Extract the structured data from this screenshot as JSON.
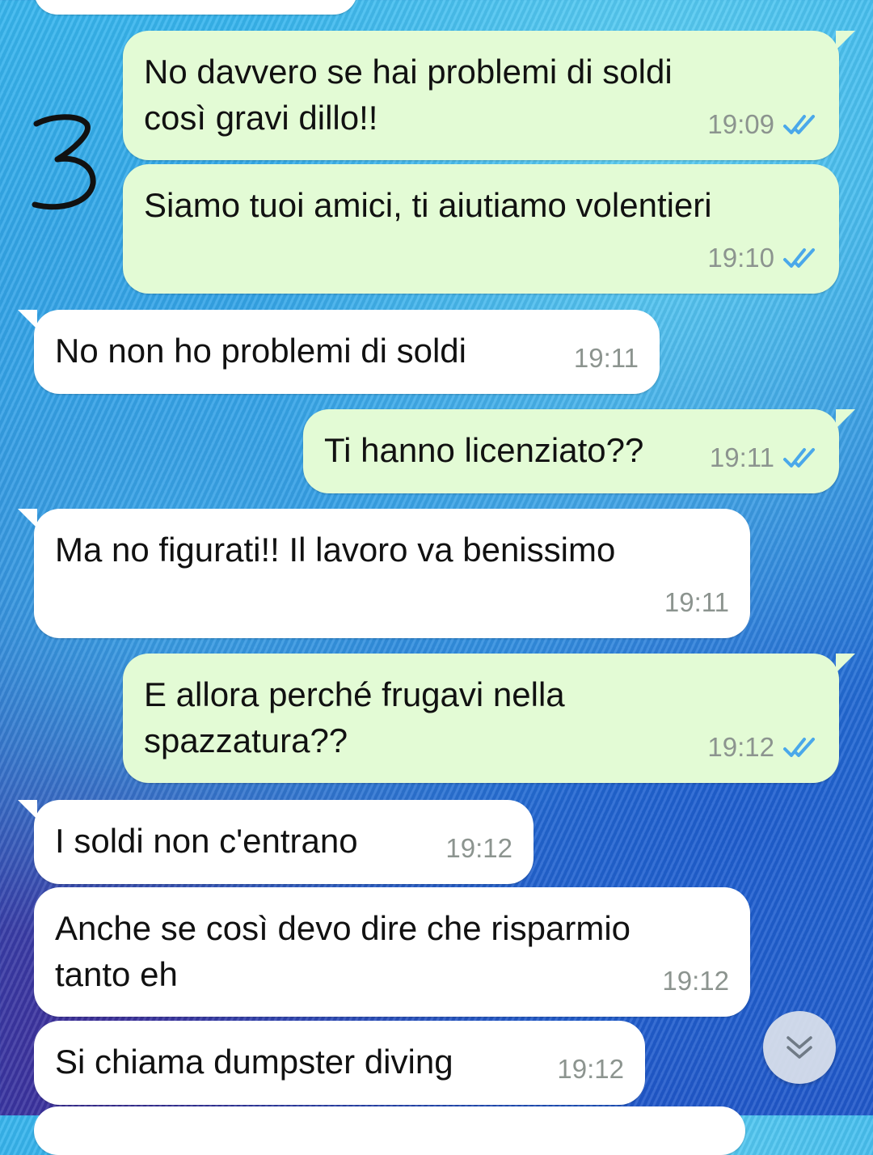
{
  "colors": {
    "outgoing_bubble": "#e3fbd5",
    "incoming_bubble": "#ffffff",
    "read_ticks": "#4aa8ea",
    "timestamp": "#8c948f"
  },
  "annotation": {
    "number": "3"
  },
  "messages": [
    {
      "direction": "outgoing",
      "lines": [
        "No davvero se hai problemi di soldi",
        "così gravi dillo!!"
      ],
      "time": "19:09",
      "status": "read",
      "status_icon": "double-check-icon"
    },
    {
      "direction": "outgoing",
      "lines": [
        "Siamo tuoi amici, ti aiutiamo volentieri"
      ],
      "time": "19:10",
      "status": "read",
      "status_icon": "double-check-icon"
    },
    {
      "direction": "incoming",
      "lines": [
        "No non ho problemi di soldi"
      ],
      "time": "19:11"
    },
    {
      "direction": "outgoing",
      "lines": [
        "Ti hanno licenziato??"
      ],
      "time": "19:11",
      "status": "read",
      "status_icon": "double-check-icon"
    },
    {
      "direction": "incoming",
      "lines": [
        "Ma no figurati!! Il lavoro va benissimo"
      ],
      "time": "19:11"
    },
    {
      "direction": "outgoing",
      "lines": [
        "E allora perché frugavi nella",
        "spazzatura??"
      ],
      "time": "19:12",
      "status": "read",
      "status_icon": "double-check-icon"
    },
    {
      "direction": "incoming",
      "lines": [
        "I soldi non c'entrano"
      ],
      "time": "19:12"
    },
    {
      "direction": "incoming",
      "lines": [
        "Anche se così devo dire che risparmio",
        "tanto eh"
      ],
      "time": "19:12"
    },
    {
      "direction": "incoming",
      "lines": [
        "Si chiama dumpster diving"
      ],
      "time": "19:12"
    }
  ],
  "scroll_button": {
    "icon": "double-chevron-down-icon"
  }
}
